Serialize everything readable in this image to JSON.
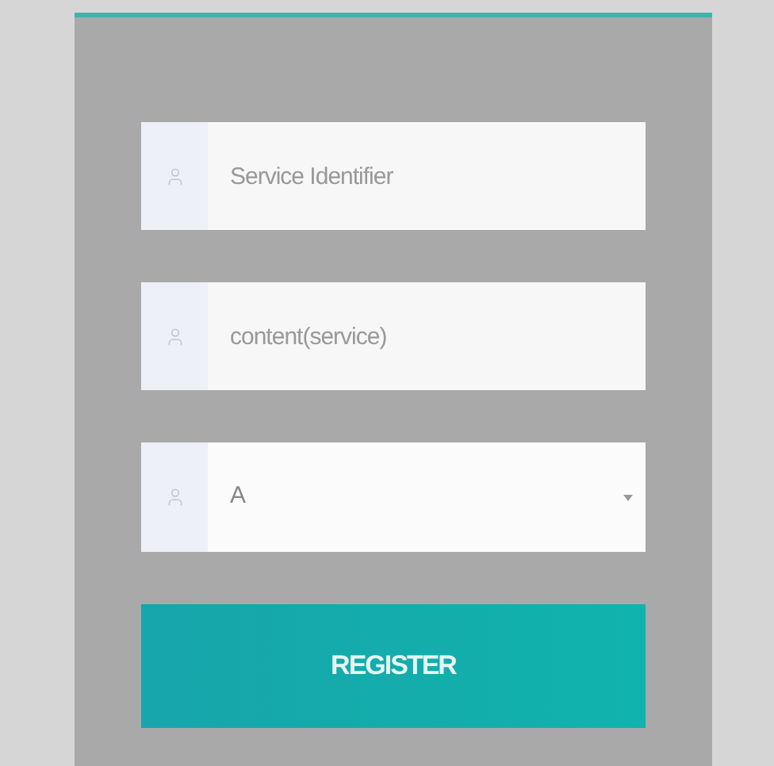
{
  "form": {
    "fields": [
      {
        "kind": "input",
        "placeholder": "Service Identifier"
      },
      {
        "kind": "input",
        "placeholder": "content(service)"
      },
      {
        "kind": "select",
        "value": "A"
      }
    ],
    "submit_button": {
      "label": "REGISTER"
    }
  }
}
